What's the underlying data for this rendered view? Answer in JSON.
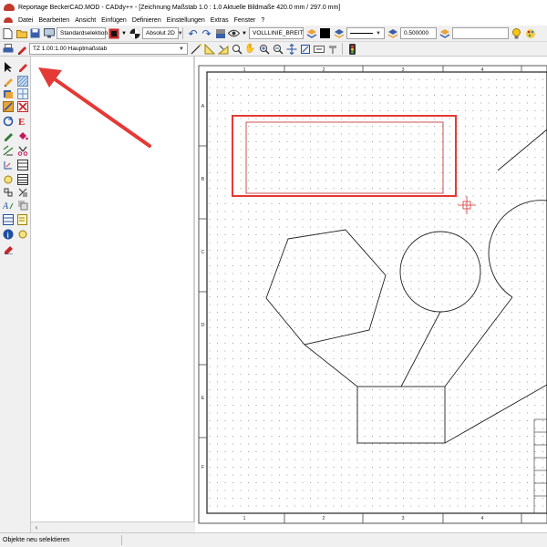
{
  "window": {
    "title": "Reportage BeckerCAD.MOD  -  CADdy++ - [Zeichnung   Maßstab 1.0 : 1.0   Aktuelle Bildmaße 420.0 mm / 297.0 mm]"
  },
  "menu": [
    "Datei",
    "Bearbeiten",
    "Ansicht",
    "Einfügen",
    "Definieren",
    "Einstellungen",
    "Extras",
    "Fenster",
    "?"
  ],
  "toolbar": {
    "selection_mode": "Standardselektion",
    "coord_mode": "Absolut 2D",
    "line_style": "VOLLLINIE_BREIT",
    "line_width": "0.500000",
    "scale": "TZ 1.00:1.00 Hauptmaßstab"
  },
  "drawing": {
    "col_labels": [
      "1",
      "2",
      "3",
      "4"
    ],
    "row_labels": [
      "A",
      "B",
      "C",
      "D",
      "E",
      "F"
    ],
    "accent": "#e53935"
  },
  "status": {
    "message": "Objekte neu selektieren"
  }
}
